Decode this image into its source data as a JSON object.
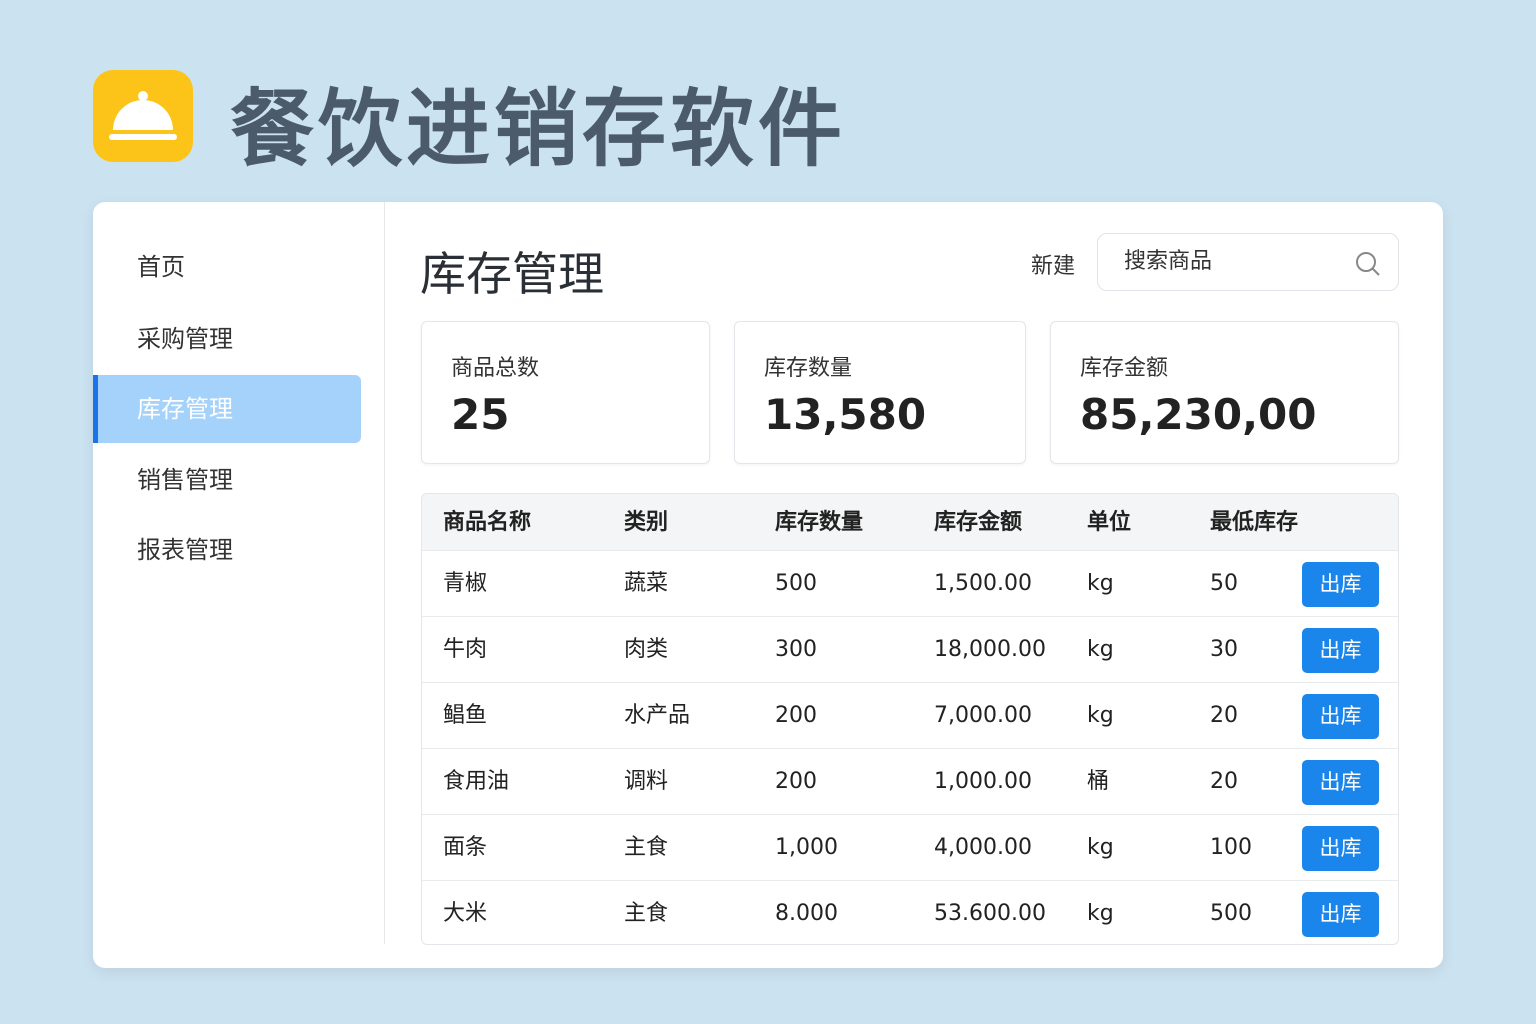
{
  "app": {
    "title": "餐饮进销存软件",
    "logo_icon": "cloche-icon"
  },
  "sidebar": {
    "items": [
      {
        "label": "首页"
      },
      {
        "label": "采购管理"
      },
      {
        "label": "库存管理",
        "active": true
      },
      {
        "label": "销售管理"
      },
      {
        "label": "报表管理"
      }
    ]
  },
  "main": {
    "title": "库存管理",
    "new_label": "新建",
    "search_placeholder": "搜索商品"
  },
  "stats": [
    {
      "label": "商品总数",
      "value": "25"
    },
    {
      "label": "库存数量",
      "value": "13,580"
    },
    {
      "label": "库存金额",
      "value": "85,230,00"
    }
  ],
  "table": {
    "headers": [
      "商品名称",
      "类别",
      "库存数量",
      "库存金额",
      "单位",
      "最低库存"
    ],
    "action_label": "出库",
    "rows": [
      [
        "青椒",
        "蔬菜",
        "500",
        "1,500.00",
        "kg",
        "50"
      ],
      [
        "牛肉",
        "肉类",
        "300",
        "18,000.00",
        "kg",
        "30"
      ],
      [
        "鲳鱼",
        "水产品",
        "200",
        "7,000.00",
        "kg",
        "20"
      ],
      [
        "食用油",
        "调料",
        "200",
        "1,000.00",
        "桶",
        "20"
      ],
      [
        "面条",
        "主食",
        "1,000",
        "4,000.00",
        "kg",
        "100"
      ],
      [
        "大米",
        "主食",
        "8.000",
        "53.600.00",
        "kg",
        "500"
      ]
    ]
  },
  "colors": {
    "accent": "#1a85ea",
    "logo": "#fcc419",
    "background": "#cbe2f0",
    "active_nav": "#a5d2fa"
  }
}
